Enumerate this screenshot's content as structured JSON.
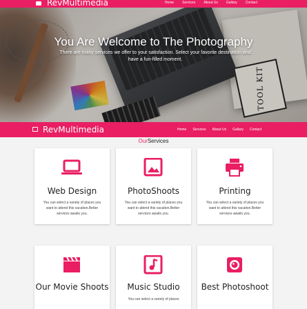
{
  "top_nav": {
    "brand": "RevMultimedia",
    "links": [
      "Home",
      "Services",
      "About Us",
      "Gallary",
      "Contact"
    ]
  },
  "hero": {
    "title": "You Are Welcome to The Photography",
    "subtitle": "There are many services we offer to your satisfaction. Select your favorite destination and have a fun-filled moment."
  },
  "main_nav": {
    "brand": "RevMultimedia",
    "links": [
      "Home",
      "Services",
      "About Us",
      "Gallary",
      "Contact"
    ]
  },
  "section": {
    "title_accent": "Our",
    "title_rest": "Services"
  },
  "cards": [
    {
      "icon": "laptop-icon",
      "title": "Web Design",
      "desc": "You can select a variety of places you want to attend this vacation.Better services awaits you."
    },
    {
      "icon": "image-icon",
      "title": "PhotoShoots",
      "desc": "You can select a variety of places you want to attend this vacation.Better services awaits you."
    },
    {
      "icon": "printer-icon",
      "title": "Printing",
      "desc": "You can select a variety of places you want to attend this vacation.Better services awaits you."
    },
    {
      "icon": "clapperboard-icon",
      "title": "Our Movie Shoots",
      "desc": ""
    },
    {
      "icon": "music-note-icon",
      "title": "Music Studio",
      "desc": "You can select a variety of places"
    },
    {
      "icon": "camera-icon",
      "title": "Best Photoshoot",
      "desc": ""
    }
  ],
  "colors": {
    "accent": "#e91e63",
    "page_bg": "#f3f3f3",
    "card_bg": "#ffffff"
  }
}
